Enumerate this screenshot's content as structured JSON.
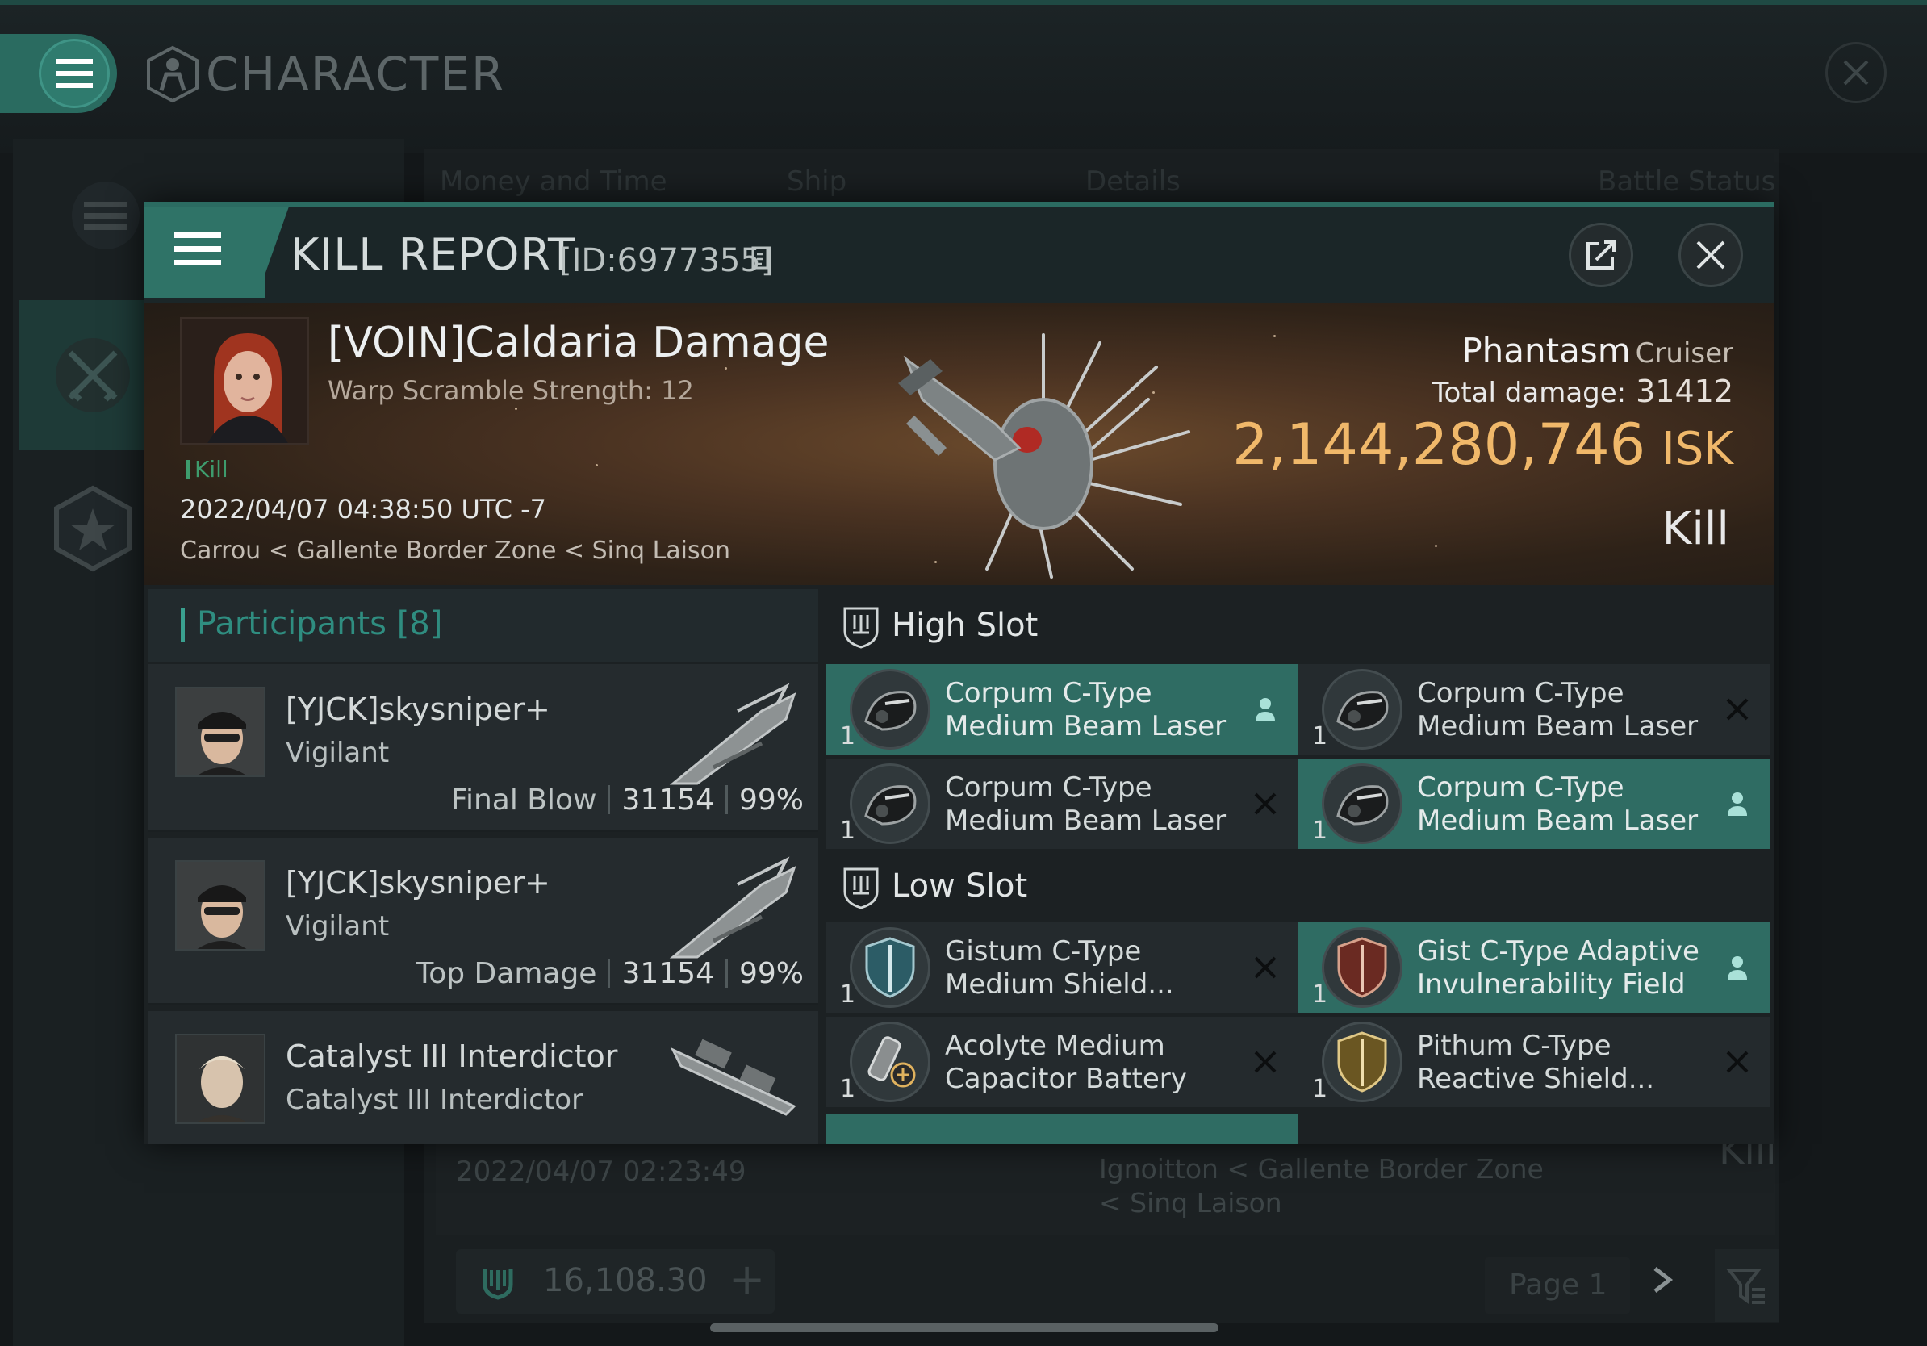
{
  "app": {
    "title": "CHARACTER"
  },
  "background": {
    "tabs": [
      "Money and Time",
      "Ship",
      "Details",
      "Battle Status"
    ],
    "row": {
      "date": "2022/04/07  02:23:49",
      "location": "Ignoitton < Gallente Border Zone < Sinq Laison",
      "result": "Kill"
    },
    "wallet": "16,108.30",
    "page": "Page 1"
  },
  "modal": {
    "title": "KILL REPORT",
    "id": "[ID:6977355]",
    "victim": {
      "name": "[VOIN]Caldaria Damage",
      "subtitle": "Warp Scramble Strength: 12",
      "tag": "Kill",
      "datetime": "2022/04/07 04:38:50 UTC -7",
      "location": "Carrou < Gallente Border Zone < Sinq Laison"
    },
    "ship": {
      "name": "Phantasm",
      "class": "Cruiser",
      "total_damage_label": "Total damage:",
      "total_damage": "31412",
      "isk": "2,144,280,746",
      "isk_unit": "ISK",
      "result": "Kill"
    },
    "participants": {
      "title": "Participants",
      "count": "[8]",
      "rows": [
        {
          "name": "[YJCK]skysniper+",
          "ship": "Vigilant",
          "role": "Final Blow",
          "damage": "31154",
          "percent": "99%"
        },
        {
          "name": "[YJCK]skysniper+",
          "ship": "Vigilant",
          "role": "Top Damage",
          "damage": "31154",
          "percent": "99%"
        },
        {
          "name": "Catalyst III Interdictor",
          "ship": "Catalyst III Interdictor",
          "role": "",
          "damage": "",
          "percent": ""
        }
      ]
    },
    "slots": {
      "high": {
        "title": "High Slot",
        "modules": [
          {
            "qty": "1",
            "name": "Corpum C-Type Medium Beam Laser",
            "state": "dropped"
          },
          {
            "qty": "1",
            "name": "Corpum C-Type Medium Beam Laser",
            "state": "destroyed"
          },
          {
            "qty": "1",
            "name": "Corpum C-Type Medium Beam Laser",
            "state": "destroyed"
          },
          {
            "qty": "1",
            "name": "Corpum C-Type Medium Beam Laser",
            "state": "dropped"
          }
        ]
      },
      "low": {
        "title": "Low Slot",
        "modules": [
          {
            "qty": "1",
            "name": "Gistum C-Type Medium Shield...",
            "state": "destroyed"
          },
          {
            "qty": "1",
            "name": "Gist C-Type Adaptive Invulnerability Field",
            "state": "dropped"
          },
          {
            "qty": "1",
            "name": "Acolyte Medium Capacitor Battery",
            "state": "destroyed"
          },
          {
            "qty": "1",
            "name": "Pithum C-Type Reactive Shield...",
            "state": "destroyed"
          }
        ]
      }
    }
  },
  "colors": {
    "accent": "#2f7367",
    "isk": "#f0b86a",
    "kill_tag": "#3e9c6d",
    "participants_title": "#2f8d80"
  }
}
